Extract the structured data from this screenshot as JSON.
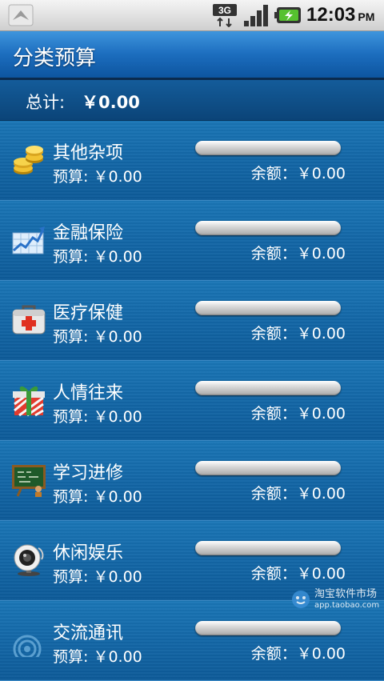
{
  "status_bar": {
    "network": "3G",
    "time": "12:03",
    "ampm": "PM"
  },
  "header": {
    "title": "分类预算"
  },
  "total": {
    "label": "总计:",
    "value": "￥0.00"
  },
  "categories": [
    {
      "name": "其他杂项",
      "budget": "预算: ￥0.00",
      "balance": "余额：￥0.00",
      "progress": 0,
      "icon": "coins-icon"
    },
    {
      "name": "金融保险",
      "budget": "预算: ￥0.00",
      "balance": "余额：￥0.00",
      "progress": 0,
      "icon": "stock-chart-icon"
    },
    {
      "name": "医疗保健",
      "budget": "预算: ￥0.00",
      "balance": "余额：￥0.00",
      "progress": 0,
      "icon": "first-aid-kit-icon"
    },
    {
      "name": "人情往来",
      "budget": "预算: ￥0.00",
      "balance": "余额：￥0.00",
      "progress": 0,
      "icon": "gift-icon"
    },
    {
      "name": "学习进修",
      "budget": "预算: ￥0.00",
      "balance": "余额：￥0.00",
      "progress": 0,
      "icon": "chalkboard-icon"
    },
    {
      "name": "休闲娱乐",
      "budget": "预算: ￥0.00",
      "balance": "余额：￥0.00",
      "progress": 0,
      "icon": "webcam-icon"
    },
    {
      "name": "交流通讯",
      "budget": "预算: ￥0.00",
      "balance": "余额：￥0.00",
      "progress": 0,
      "icon": "signal-icon"
    }
  ],
  "watermark": {
    "title": "淘宝软件市场",
    "url": "app.taobao.com"
  }
}
